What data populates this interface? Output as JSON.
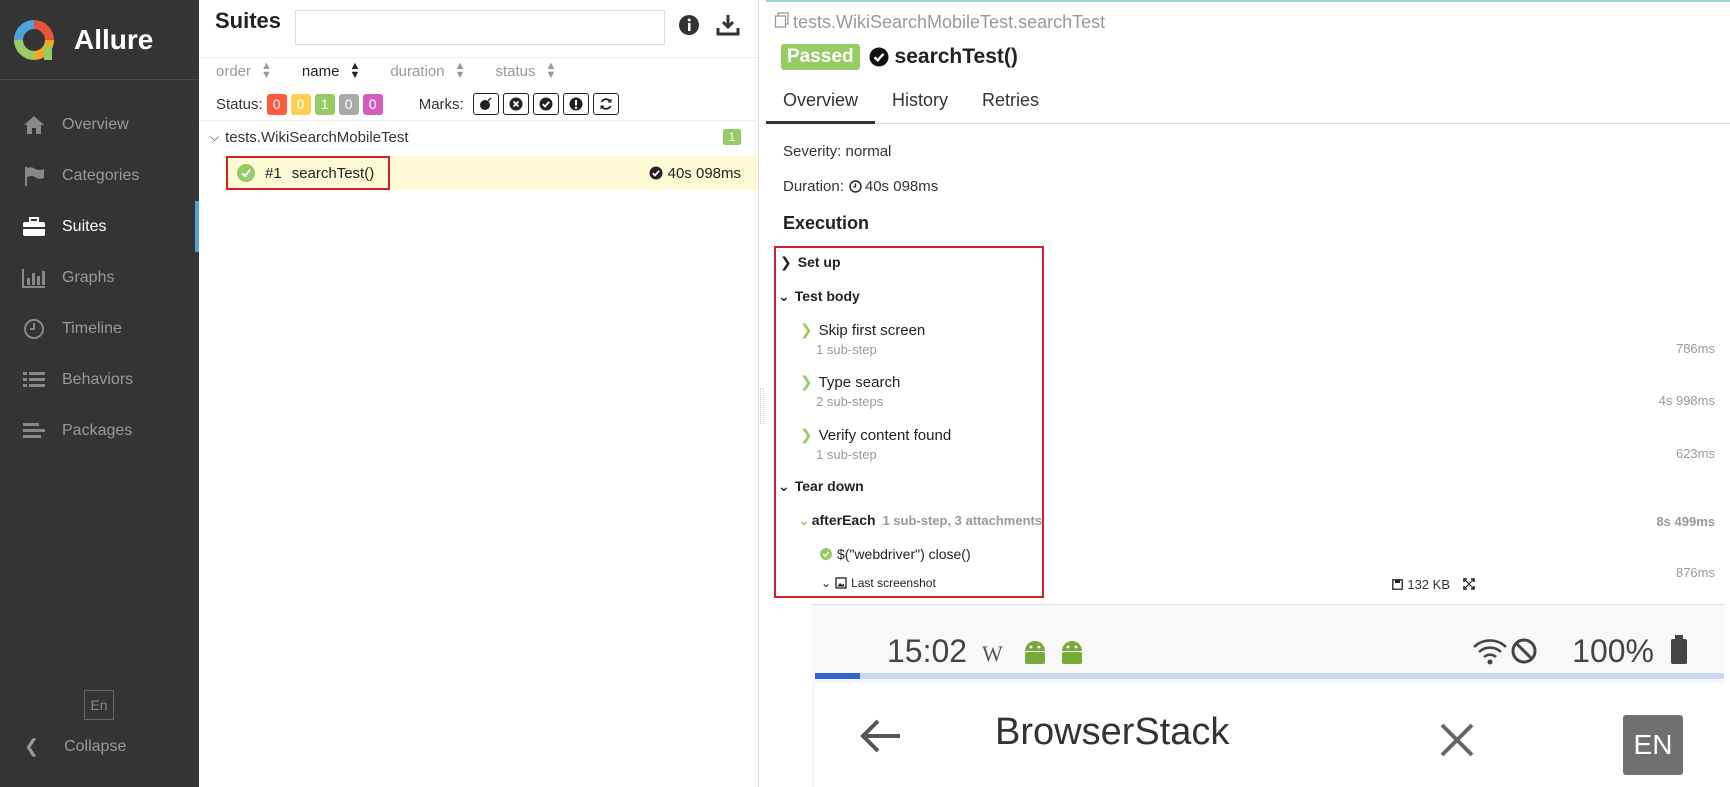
{
  "app": {
    "name": "Allure",
    "lang": "En",
    "collapse_label": "Collapse"
  },
  "sidebar": {
    "items": [
      {
        "label": "Overview",
        "icon": "home-icon"
      },
      {
        "label": "Categories",
        "icon": "flag-icon"
      },
      {
        "label": "Suites",
        "icon": "briefcase-icon",
        "active": true
      },
      {
        "label": "Graphs",
        "icon": "bar-chart-icon"
      },
      {
        "label": "Timeline",
        "icon": "clock-icon"
      },
      {
        "label": "Behaviors",
        "icon": "list-icon"
      },
      {
        "label": "Packages",
        "icon": "align-left-icon"
      }
    ]
  },
  "tree": {
    "title": "Suites",
    "search_value": "",
    "sort": {
      "order": "order",
      "name": "name",
      "duration": "duration",
      "status": "status"
    },
    "status_label": "Status:",
    "status_counts": [
      {
        "value": "0",
        "color": "#fd5a3e"
      },
      {
        "value": "0",
        "color": "#ffd050"
      },
      {
        "value": "1",
        "color": "#97cc64"
      },
      {
        "value": "0",
        "color": "#aaaaaa"
      },
      {
        "value": "0",
        "color": "#d35ebe"
      }
    ],
    "marks_label": "Marks:",
    "group": {
      "name": "tests.WikiSearchMobileTest",
      "count": "1"
    },
    "test": {
      "number": "#1",
      "name": "searchTest()",
      "duration": "40s 098ms"
    }
  },
  "detail": {
    "full_name": "tests.WikiSearchMobileTest.searchTest",
    "status": "Passed",
    "title": "searchTest()",
    "tabs": [
      "Overview",
      "History",
      "Retries"
    ],
    "severity": "Severity: normal",
    "duration_label": "Duration:",
    "duration": "40s 098ms",
    "execution_title": "Execution",
    "setup_label": "Set up",
    "body_label": "Test body",
    "steps": [
      {
        "name": "Skip first screen",
        "sub": "1 sub-step",
        "duration": "786ms"
      },
      {
        "name": "Type search",
        "sub": "2 sub-steps",
        "duration": "4s 998ms"
      },
      {
        "name": "Verify content found",
        "sub": "1 sub-step",
        "duration": "623ms"
      }
    ],
    "teardown_label": "Tear down",
    "after_each": {
      "name": "afterEach",
      "meta": "1 sub-step, 3 attachments",
      "duration": "8s 499ms"
    },
    "close_step": {
      "name": "$(\"webdriver\") close()",
      "duration": "876ms"
    },
    "attachment": {
      "name": "Last screenshot",
      "size": "132 KB"
    }
  },
  "screenshot": {
    "time": "15:02",
    "wiki_glyph": "W",
    "battery": "100%",
    "progress": 0.05,
    "query": "BrowserStack",
    "keyboard_lang": "EN"
  }
}
